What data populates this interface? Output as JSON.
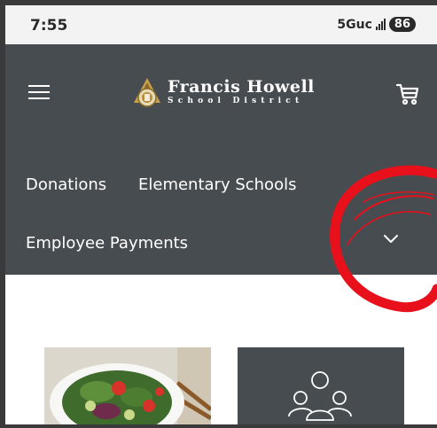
{
  "status_bar": {
    "time": "7:55",
    "network": "5Guc",
    "battery": "86"
  },
  "header": {
    "logo_name": "Francis Howell",
    "logo_sub": "School District",
    "menu_icon": "hamburger-icon",
    "cart_icon": "cart-icon"
  },
  "nav": {
    "items": [
      {
        "label": "Donations"
      },
      {
        "label": "Elementary Schools"
      },
      {
        "label": "Employee Payments"
      }
    ],
    "expand_icon": "chevron-down-icon"
  },
  "cards": [
    {
      "image": "salad-image"
    },
    {
      "image": "people-group-icon"
    }
  ],
  "colors": {
    "navbar_bg": "#474c51",
    "status_bg": "#f3f3f3",
    "annotation": "#e8101a",
    "logo_gold": "#c9a14a"
  }
}
